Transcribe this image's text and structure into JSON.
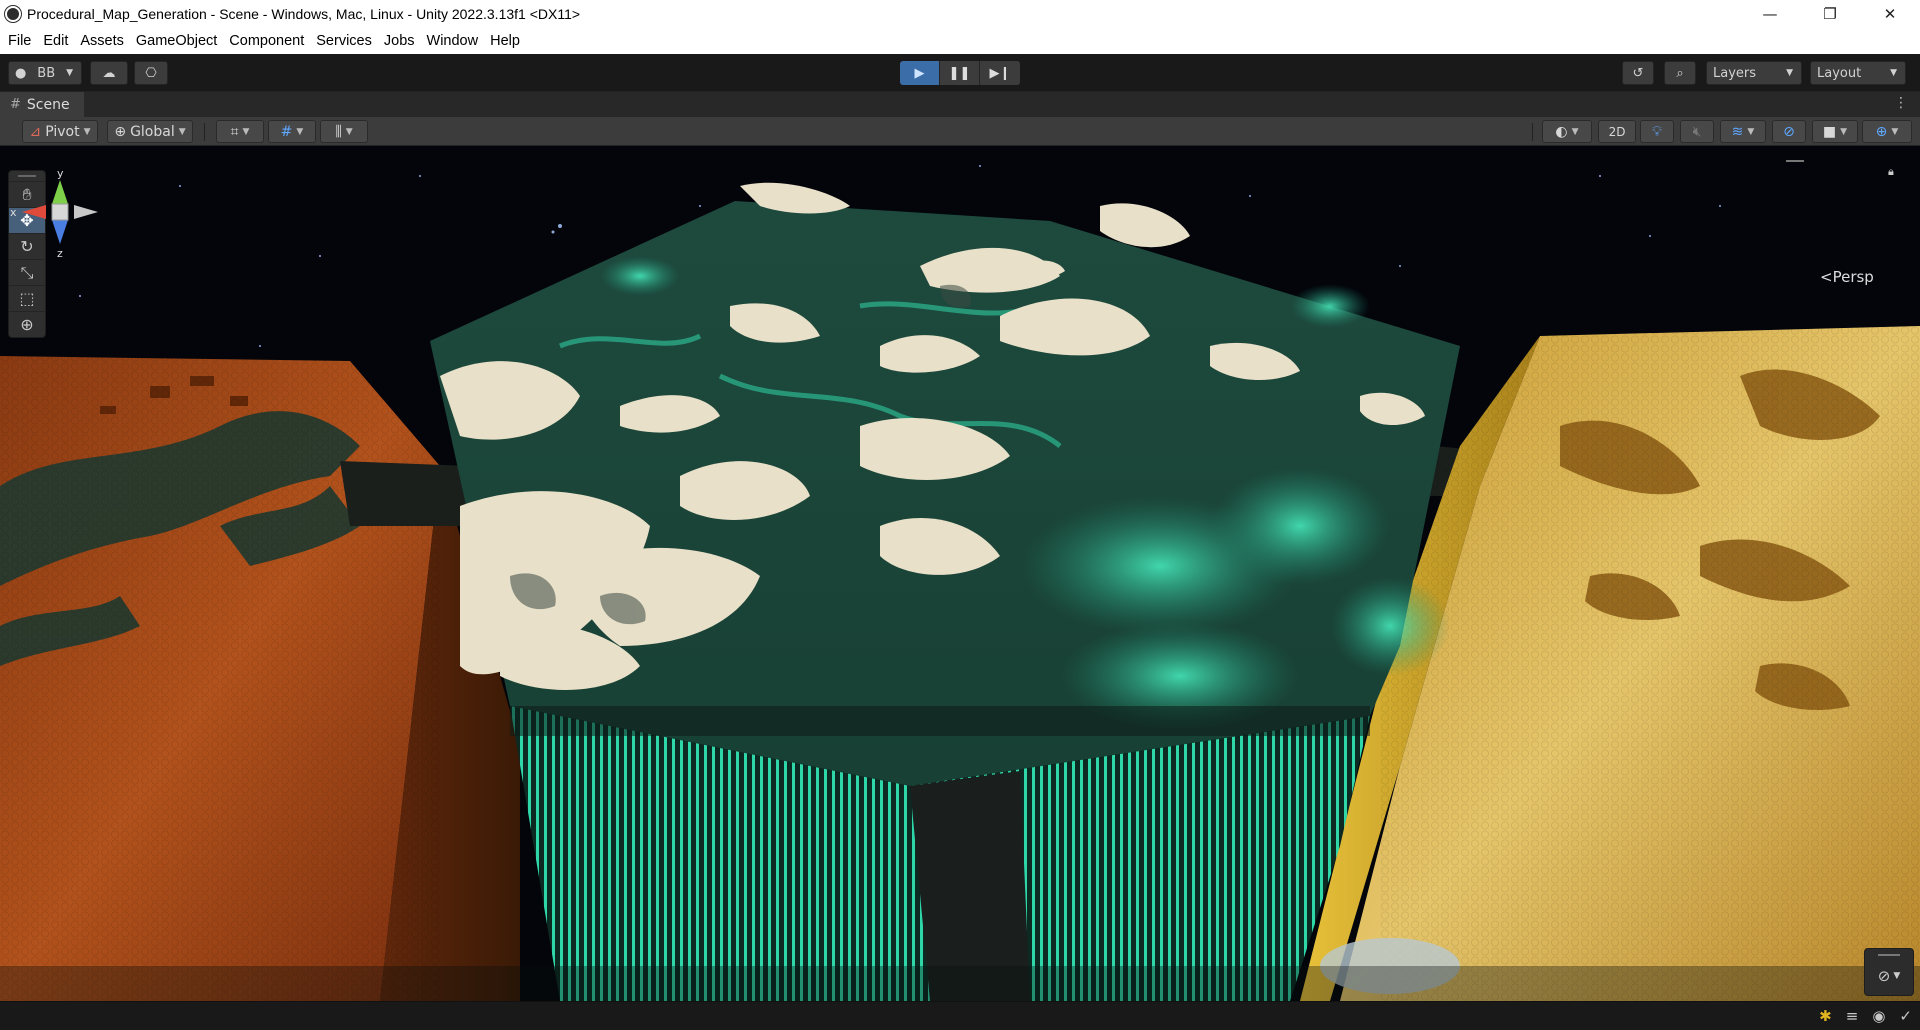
{
  "window": {
    "title": "Procedural_Map_Generation - Scene - Windows, Mac, Linux - Unity 2022.3.13f1 <DX11>",
    "controls": {
      "minimize": "—",
      "maximize": "❐",
      "close": "✕"
    }
  },
  "menu": [
    "File",
    "Edit",
    "Assets",
    "GameObject",
    "Component",
    "Services",
    "Jobs",
    "Window",
    "Help"
  ],
  "toolbar": {
    "account_label": "BB",
    "play_state": "playing",
    "layers_label": "Layers",
    "layout_label": "Layout"
  },
  "scene_tab": {
    "label": "Scene"
  },
  "scene_toolbar": {
    "pivot_label": "Pivot",
    "global_label": "Global",
    "mode_2d_label": "2D"
  },
  "gizmo": {
    "x_label": "x",
    "y_label": "y",
    "z_label": "z",
    "projection_label": "Persp"
  },
  "icons": {
    "account": "account-icon",
    "cloud": "cloud-icon",
    "collab": "collab-icon",
    "history": "history-icon",
    "search": "search-icon",
    "hand": "hand-tool-icon",
    "move": "move-tool-icon",
    "rotate": "rotate-tool-icon",
    "scale": "scale-tool-icon",
    "rect": "rect-tool-icon",
    "transform": "transform-tool-icon"
  },
  "colors": {
    "play_active": "#3b6ea8",
    "accent_blue": "#5fa8ff",
    "warning": "#e0b420"
  }
}
